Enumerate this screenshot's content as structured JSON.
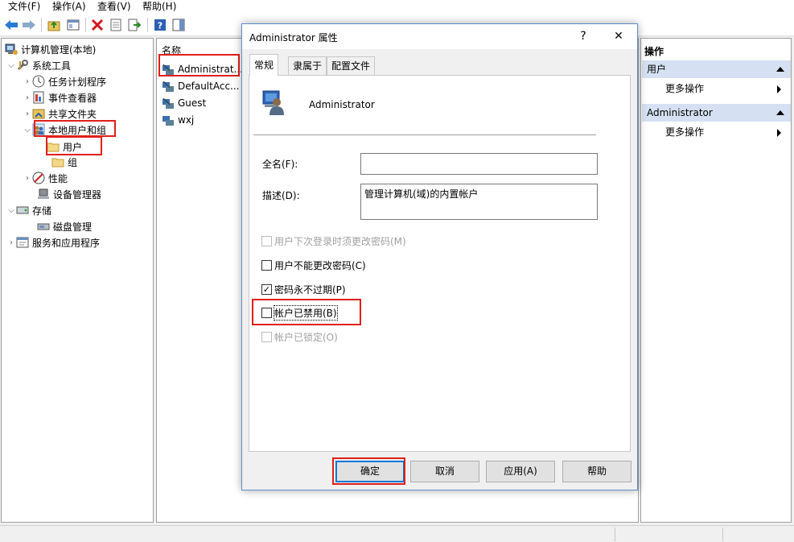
{
  "menu": [
    "文件(F)",
    "操作(A)",
    "查看(V)",
    "帮助(H)"
  ],
  "tree": {
    "root": "计算机管理(本地)",
    "system_tools": "系统工具",
    "task_scheduler": "任务计划程序",
    "event_viewer": "事件查看器",
    "shared_folders": "共享文件夹",
    "local_users_groups": "本地用户和组",
    "users": "用户",
    "groups": "组",
    "performance": "性能",
    "device_manager": "设备管理器",
    "storage": "存储",
    "disk_management": "磁盘管理",
    "services_apps": "服务和应用程序"
  },
  "list": {
    "header": "名称",
    "rows": [
      "Administrat...",
      "DefaultAcc...",
      "Guest",
      "wxj"
    ]
  },
  "actions": {
    "title": "操作",
    "section1": "用户",
    "section1_item": "更多操作",
    "section2": "Administrator",
    "section2_item": "更多操作"
  },
  "dialog": {
    "title": "Administrator 属性",
    "help": "?",
    "close": "✕",
    "tabs": [
      "常规",
      "隶属于",
      "配置文件"
    ],
    "username": "Administrator",
    "fullname_label": "全名(F):",
    "fullname_value": "",
    "desc_label": "描述(D):",
    "desc_value": "管理计算机(域)的内置帐户",
    "cb_must_change": "用户下次登录时须更改密码(M)",
    "cb_cannot_change": "用户不能更改密码(C)",
    "cb_never_expires": "密码永不过期(P)",
    "cb_disabled": "帐户已禁用(B)",
    "cb_locked": "帐户已锁定(O)",
    "checked_mark": "✓",
    "ok": "确定",
    "cancel": "取消",
    "apply": "应用(A)",
    "helpbtn": "帮助"
  }
}
